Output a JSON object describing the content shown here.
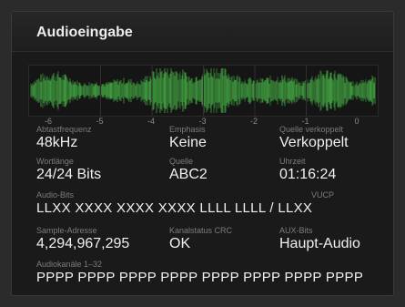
{
  "panel": {
    "title": "Audioeingabe"
  },
  "meter": {
    "scale_labels": [
      "-6",
      "-5",
      "-4",
      "-3",
      "-2",
      "-1",
      "0"
    ],
    "waveform_color": "#3f9a3f"
  },
  "fields": {
    "sample_rate": {
      "label": "Abtastfrequenz",
      "value": "48kHz"
    },
    "emphasis": {
      "label": "Emphasis",
      "value": "Keine"
    },
    "source_locked": {
      "label": "Quelle verkoppelt",
      "value": "Verkoppelt"
    },
    "word_length": {
      "label": "Wortlänge",
      "value": "24/24 Bits"
    },
    "source": {
      "label": "Quelle",
      "value": "ABC2"
    },
    "time": {
      "label": "Uhrzeit",
      "value": "01:16:24"
    },
    "audio_bits": {
      "label": "Audio-Bits",
      "vucp_label": "VUCP",
      "value": "LLXX XXXX XXXX XXXX LLLL LLLL / LLXX"
    },
    "sample_address": {
      "label": "Sample-Adresse",
      "value": "4,294,967,295"
    },
    "channel_status_crc": {
      "label": "Kanalstatus CRC",
      "value": "OK"
    },
    "aux_bits": {
      "label": "AUX-Bits",
      "value": "Haupt-Audio"
    },
    "audio_channels": {
      "label": "Audiokanäle 1–32",
      "value": "PPPP PPPP PPPP PPPP PPPP PPPP PPPP PPPP"
    }
  }
}
